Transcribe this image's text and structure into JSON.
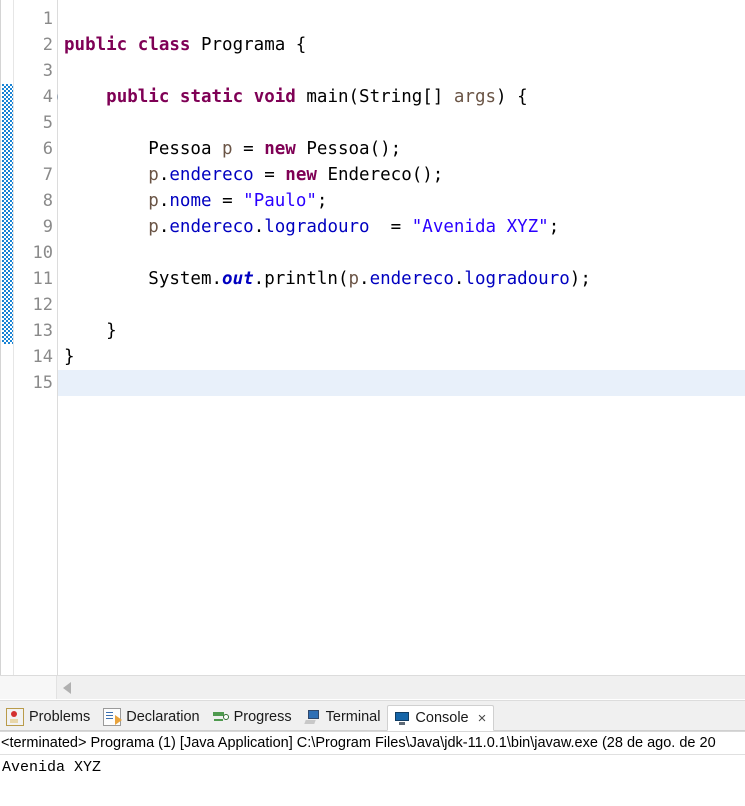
{
  "editor": {
    "current_line": 15,
    "fold_marker_line": 4,
    "annotation_band": {
      "from_line": 4,
      "to_line": 13
    },
    "lines": [
      {
        "number": "1",
        "tokens": []
      },
      {
        "number": "2",
        "tokens": [
          {
            "t": "public",
            "c": "kw"
          },
          {
            "t": " ",
            "c": "plain"
          },
          {
            "t": "class",
            "c": "kw"
          },
          {
            "t": " Programa {",
            "c": "plain"
          }
        ]
      },
      {
        "number": "3",
        "tokens": []
      },
      {
        "number": "4",
        "tokens": [
          {
            "t": "    ",
            "c": "plain"
          },
          {
            "t": "public",
            "c": "kw"
          },
          {
            "t": " ",
            "c": "plain"
          },
          {
            "t": "static",
            "c": "kw"
          },
          {
            "t": " ",
            "c": "plain"
          },
          {
            "t": "void",
            "c": "kw"
          },
          {
            "t": " main(String[] ",
            "c": "plain"
          },
          {
            "t": "args",
            "c": "local"
          },
          {
            "t": ") {",
            "c": "plain"
          }
        ]
      },
      {
        "number": "5",
        "tokens": []
      },
      {
        "number": "6",
        "tokens": [
          {
            "t": "        Pessoa ",
            "c": "plain"
          },
          {
            "t": "p",
            "c": "local"
          },
          {
            "t": " = ",
            "c": "plain"
          },
          {
            "t": "new",
            "c": "kw"
          },
          {
            "t": " Pessoa();",
            "c": "plain"
          }
        ]
      },
      {
        "number": "7",
        "tokens": [
          {
            "t": "        ",
            "c": "plain"
          },
          {
            "t": "p",
            "c": "local"
          },
          {
            "t": ".",
            "c": "plain"
          },
          {
            "t": "endereco",
            "c": "field"
          },
          {
            "t": " = ",
            "c": "plain"
          },
          {
            "t": "new",
            "c": "kw"
          },
          {
            "t": " Endereco();",
            "c": "plain"
          }
        ]
      },
      {
        "number": "8",
        "tokens": [
          {
            "t": "        ",
            "c": "plain"
          },
          {
            "t": "p",
            "c": "local"
          },
          {
            "t": ".",
            "c": "plain"
          },
          {
            "t": "nome",
            "c": "field"
          },
          {
            "t": " = ",
            "c": "plain"
          },
          {
            "t": "\"Paulo\"",
            "c": "str"
          },
          {
            "t": ";",
            "c": "plain"
          }
        ]
      },
      {
        "number": "9",
        "tokens": [
          {
            "t": "        ",
            "c": "plain"
          },
          {
            "t": "p",
            "c": "local"
          },
          {
            "t": ".",
            "c": "plain"
          },
          {
            "t": "endereco",
            "c": "field"
          },
          {
            "t": ".",
            "c": "plain"
          },
          {
            "t": "logradouro",
            "c": "field"
          },
          {
            "t": "  = ",
            "c": "plain"
          },
          {
            "t": "\"Avenida XYZ\"",
            "c": "str"
          },
          {
            "t": ";",
            "c": "plain"
          }
        ]
      },
      {
        "number": "10",
        "tokens": []
      },
      {
        "number": "11",
        "tokens": [
          {
            "t": "        System.",
            "c": "plain"
          },
          {
            "t": "out",
            "c": "sfield"
          },
          {
            "t": ".println(",
            "c": "plain"
          },
          {
            "t": "p",
            "c": "local"
          },
          {
            "t": ".",
            "c": "plain"
          },
          {
            "t": "endereco",
            "c": "field"
          },
          {
            "t": ".",
            "c": "plain"
          },
          {
            "t": "logradouro",
            "c": "field"
          },
          {
            "t": ");",
            "c": "plain"
          }
        ]
      },
      {
        "number": "12",
        "tokens": []
      },
      {
        "number": "13",
        "tokens": [
          {
            "t": "    }",
            "c": "plain"
          }
        ]
      },
      {
        "number": "14",
        "tokens": [
          {
            "t": "}",
            "c": "plain"
          }
        ]
      },
      {
        "number": "15",
        "tokens": []
      }
    ]
  },
  "bottom_panel": {
    "tabs": [
      {
        "label": "Problems",
        "icon": "problems-icon",
        "icon_class": "icon-problems",
        "active": false,
        "closable": false
      },
      {
        "label": "Declaration",
        "icon": "declaration-icon",
        "icon_class": "icon-declaration",
        "active": false,
        "closable": false
      },
      {
        "label": "Progress",
        "icon": "progress-icon",
        "icon_class": "icon-progress",
        "active": false,
        "closable": false
      },
      {
        "label": "Terminal",
        "icon": "terminal-icon",
        "icon_class": "icon-terminal",
        "active": false,
        "closable": false
      },
      {
        "label": "Console",
        "icon": "console-icon",
        "icon_class": "icon-console",
        "active": true,
        "closable": true
      }
    ],
    "close_glyph": "×",
    "console": {
      "header": "<terminated> Programa (1) [Java Application] C:\\Program Files\\Java\\jdk-11.0.1\\bin\\javaw.exe  (28 de ago. de 20",
      "output": "Avenida XYZ"
    }
  },
  "colors": {
    "keyword": "#7f0055",
    "string": "#2a00ff",
    "field": "#0000c0",
    "local_var": "#6a5445",
    "line_number": "#8a8a8a",
    "current_line_bg": "#e8f0fa",
    "annotation_band": "#1b84d4",
    "tab_bar_bg": "#f0f0f0"
  }
}
